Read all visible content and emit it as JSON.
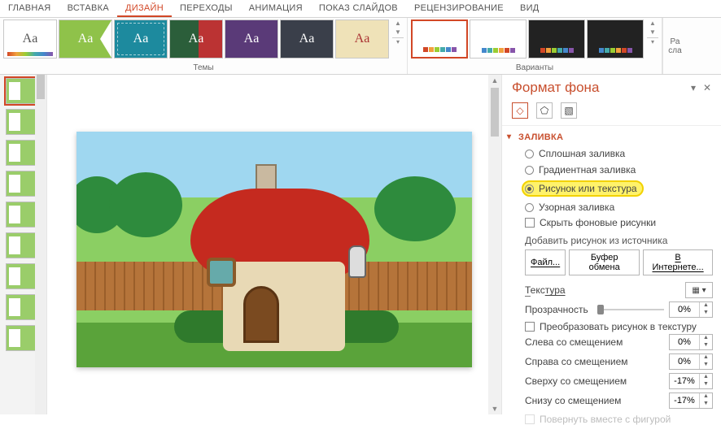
{
  "ribbon": {
    "tabs": [
      "ГЛАВНАЯ",
      "ВСТАВКА",
      "ДИЗАЙН",
      "ПЕРЕХОДЫ",
      "АНИМАЦИЯ",
      "ПОКАЗ СЛАЙДОВ",
      "РЕЦЕНЗИРОВАНИЕ",
      "ВИД"
    ],
    "active_index": 2,
    "themes_label": "Темы",
    "variants_label": "Варианты",
    "right_stub_l1": "Ра",
    "right_stub_l2": "сла"
  },
  "pane": {
    "title": "Формат фона",
    "section_fill": "ЗАЛИВКА",
    "fill_options": {
      "solid": "Сплошная заливка",
      "gradient": "Градиентная заливка",
      "picture": "Рисунок или текстура",
      "pattern": "Узорная заливка",
      "selected": "picture"
    },
    "hide_bg": "Скрыть фоновые рисунки",
    "insert_from": "Добавить рисунок из источника",
    "btn_file": "Файл...",
    "btn_clipboard": "Буфер обмена",
    "btn_online": "В Интернете...",
    "texture_label": "Текстура",
    "transparency_label": "Прозрачность",
    "transparency_value": "0%",
    "tile_label": "Преобразовать рисунок в текстуру",
    "offset_left_label": "Слева со смещением",
    "offset_left_value": "0%",
    "offset_right_label": "Справа со смещением",
    "offset_right_value": "0%",
    "offset_top_label": "Сверху со смещением",
    "offset_top_value": "-17%",
    "offset_bottom_label": "Снизу со смещением",
    "offset_bottom_value": "-17%",
    "rotate_label": "Повернуть вместе с фигурой"
  }
}
